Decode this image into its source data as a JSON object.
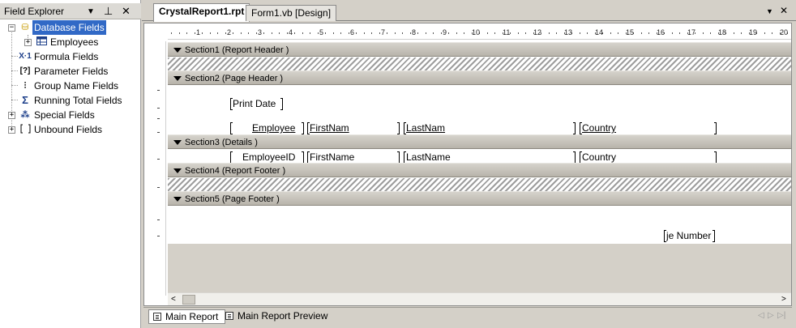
{
  "field_explorer": {
    "title": "Field Explorer",
    "controls": {
      "dropdown": "▼",
      "pin": "⊥",
      "close": "✕"
    },
    "items": [
      {
        "label": "Database Fields",
        "icon": "database-icon",
        "expander": "−",
        "selected": true
      },
      {
        "label": "Employees",
        "icon": "table-icon",
        "expander": "+"
      },
      {
        "label": "Formula Fields",
        "icon": "formula-icon",
        "glyph": "X·1"
      },
      {
        "label": "Parameter Fields",
        "icon": "parameter-icon",
        "glyph": "[?]"
      },
      {
        "label": "Group Name Fields",
        "icon": "group-name-icon",
        "glyph": "⫶"
      },
      {
        "label": "Running Total Fields",
        "icon": "running-total-icon",
        "glyph": "Σ"
      },
      {
        "label": "Special Fields",
        "icon": "special-fields-icon",
        "expander": "+"
      },
      {
        "label": "Unbound Fields",
        "icon": "unbound-fields-icon",
        "expander": "+"
      }
    ]
  },
  "document_tabs": [
    {
      "label": "CrystalReport1.rpt",
      "active": true
    },
    {
      "label": "Form1.vb [Design]",
      "active": false
    }
  ],
  "window_controls": {
    "dropdown": "▼",
    "close": "✕"
  },
  "ruler": {
    "numbers": [
      "1",
      "2",
      "3",
      "4",
      "5",
      "6",
      "7",
      "8",
      "9",
      "10",
      "11",
      "12",
      "13",
      "14",
      "15",
      "16",
      "17",
      "18",
      "19",
      "20"
    ]
  },
  "sections": [
    {
      "label": "Section1 (Report Header  )"
    },
    {
      "label": "Section2 (Page Header  )"
    },
    {
      "label": "Section3 (Details  )"
    },
    {
      "label": "Section4 (Report Footer  )"
    },
    {
      "label": "Section5 (Page Footer  )"
    }
  ],
  "fields": {
    "print_date": "Print Date",
    "header_employee": "Employee",
    "header_firstname": "FirstNam",
    "header_lastname": "LastNam",
    "header_country": "Country",
    "detail_employeeid": "EmployeeID",
    "detail_firstname": "FirstName",
    "detail_lastname": "LastName",
    "detail_country": "Country",
    "page_number": "je Number"
  },
  "scroll": {
    "left": "<",
    "right": ">"
  },
  "bottom_tabs": [
    {
      "label": "Main Report",
      "active": true
    },
    {
      "label": "Main Report Preview",
      "active": false
    }
  ],
  "nav_controls": [
    "◁",
    "▷",
    "▷|"
  ]
}
